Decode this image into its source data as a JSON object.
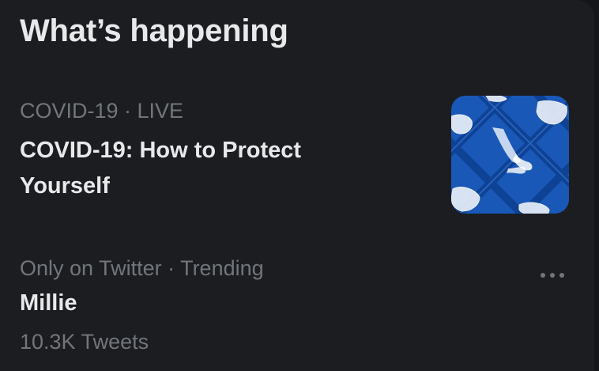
{
  "section": {
    "title": "What’s happening"
  },
  "trends": [
    {
      "context": "COVID-19 · LIVE",
      "headline_line1": "COVID-19: How to Protect",
      "headline_line2": "Yourself",
      "thumbnail": "covid-19-illustration",
      "accent_color": "#1958b7"
    },
    {
      "context": "Only on Twitter · Trending",
      "headline": "Millie",
      "tweet_count": "10.3K Tweets",
      "menu_icon": "more-horizontal-icon"
    }
  ],
  "colors": {
    "background": "#1c1d21",
    "primary_text": "#e7e9ea",
    "secondary_text": "#71767b"
  }
}
